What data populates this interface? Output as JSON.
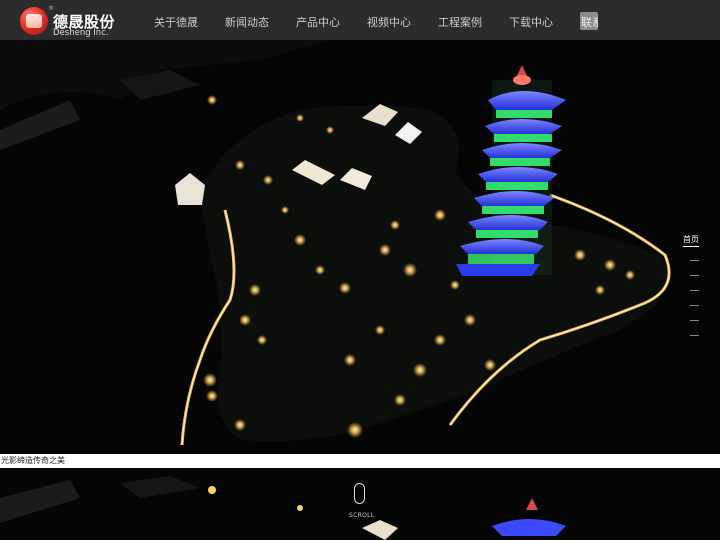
{
  "brand": {
    "name_cn": "德晟股份",
    "name_en": "Desheng Inc.",
    "registered_mark": "®"
  },
  "nav": {
    "items": [
      "关于德晟",
      "新闻动态",
      "产品中心",
      "视频中心",
      "工程案例",
      "下载中心"
    ],
    "contact_label": "联系我们"
  },
  "hero": {
    "caption": "光影缔造传奇之美"
  },
  "side_pager": {
    "home_label": "首页",
    "dot_count": 5
  },
  "scroll": {
    "label": "SCROLL"
  },
  "colors": {
    "header_bg": "#2b2b2b",
    "pagoda_blue": "#3a4bff",
    "pagoda_green": "#3bff7a",
    "light_gold": "#ffcf6a"
  }
}
